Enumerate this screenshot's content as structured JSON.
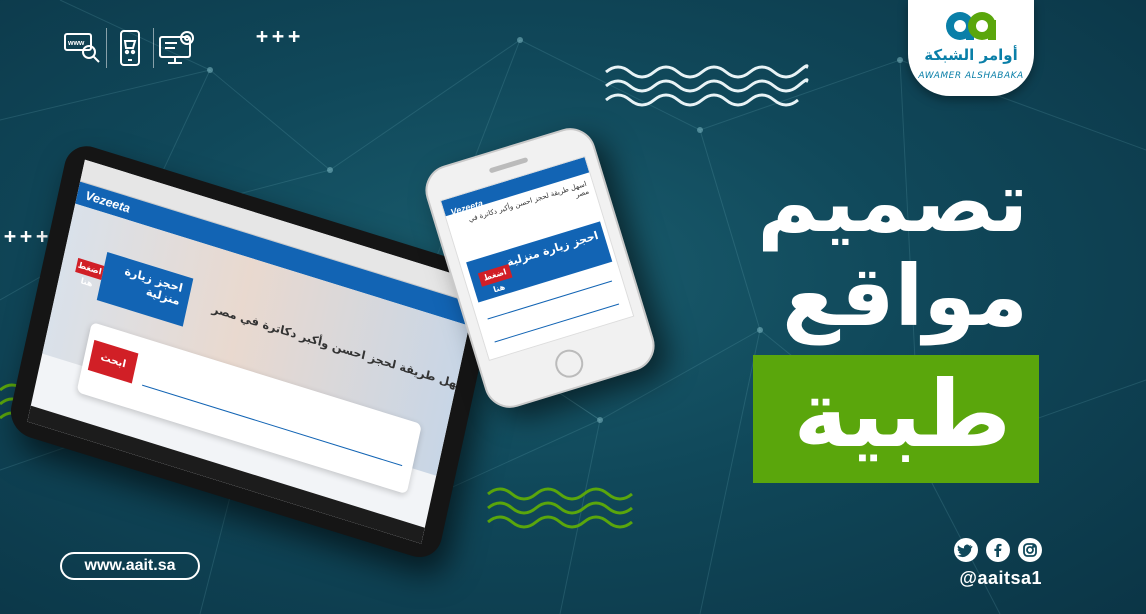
{
  "colors": {
    "background": "#10485a",
    "accent_green": "#5aa60c",
    "brand_blue": "#0a7fa8",
    "site_blue": "#1264b4",
    "site_red": "#d11f26"
  },
  "logo": {
    "arabic_name": "أوامر الشبكة",
    "latin_name": "AWAMER ALSHABAKA",
    "icon": "aa-monogram-icon"
  },
  "headline": {
    "line1": "تصميم",
    "line2": "مواقع",
    "line3": "طبية"
  },
  "top_icons": [
    "www-search-icon",
    "mobile-cart-icon",
    "monitor-settings-icon"
  ],
  "decor": {
    "plus_marks": "+++"
  },
  "website_url": "www.aait.sa",
  "social": {
    "icons": [
      "twitter-icon",
      "facebook-icon",
      "instagram-icon"
    ],
    "handle": "@aaitsa1"
  },
  "mockup": {
    "brand": "Vezeeta",
    "hero_text": "اسهل طريقة لحجز احسن وأكبر دكاترة في مصر",
    "card_text": "احجز زيارة منزلية",
    "cta": "اضغط هنا",
    "search_button": "ابحث"
  }
}
